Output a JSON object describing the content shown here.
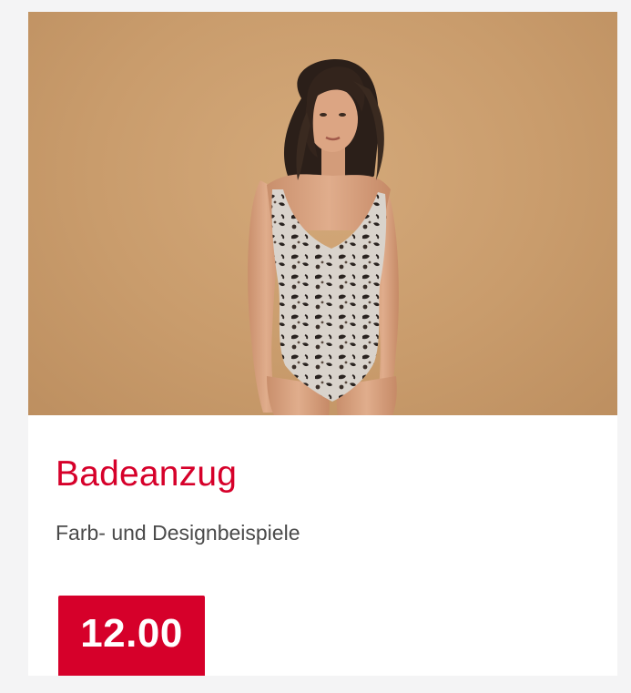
{
  "product": {
    "title": "Badeanzug",
    "subtitle": "Farb- und Designbeispiele",
    "price": "12.00",
    "image_subject": "woman wearing leopard-print one-piece swimsuit"
  },
  "colors": {
    "accent": "#d6002a",
    "text_secondary": "#4a4a4a",
    "image_background": "#c99c6c",
    "page_background": "#f4f4f5"
  }
}
